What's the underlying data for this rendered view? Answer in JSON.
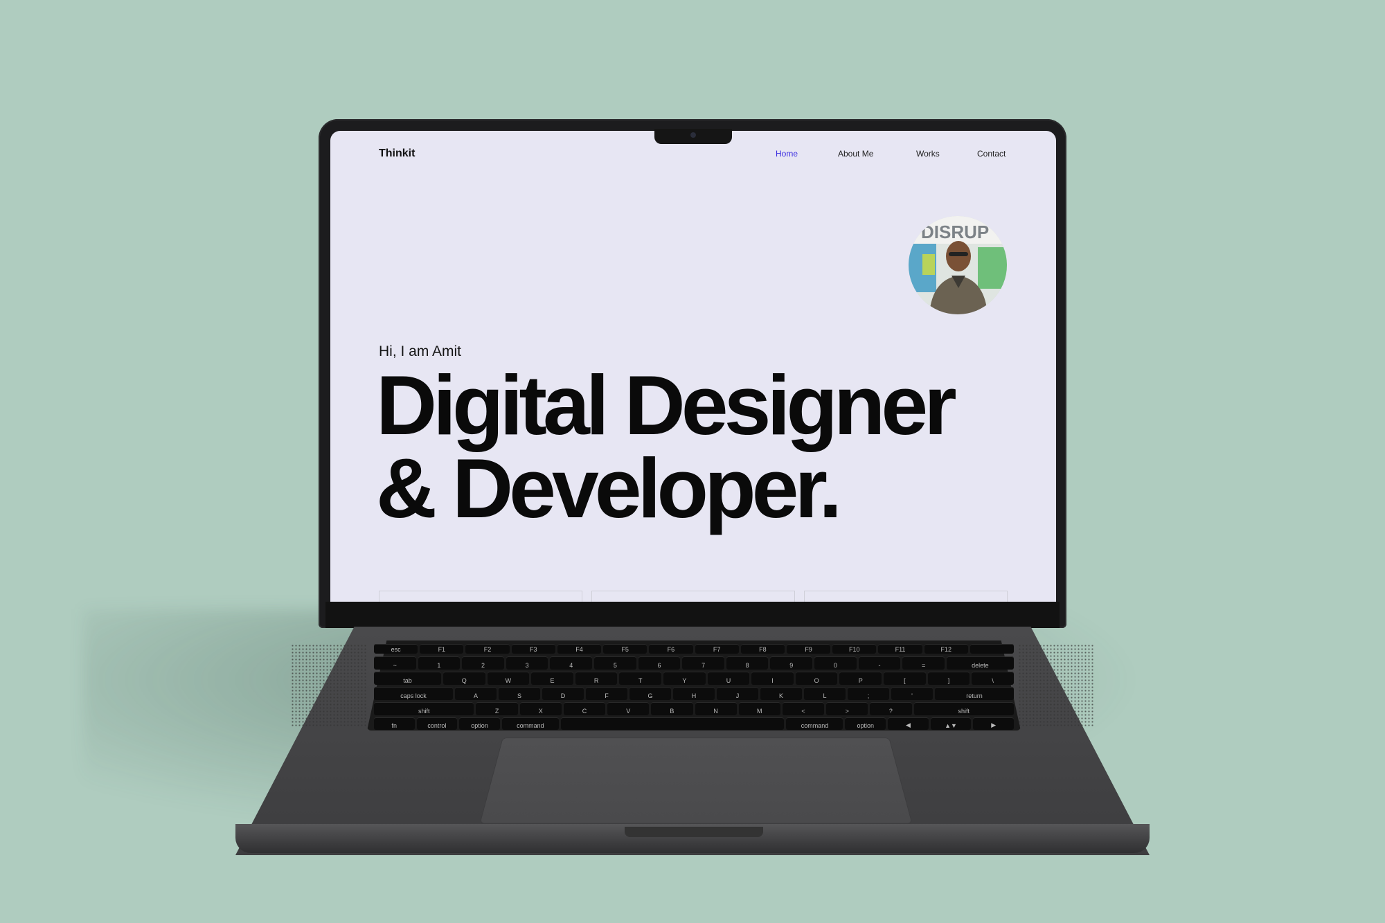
{
  "site": {
    "logo": "Thinkit",
    "nav": [
      {
        "label": "Home",
        "active": true
      },
      {
        "label": "About Me",
        "active": false
      },
      {
        "label": "Works",
        "active": false
      },
      {
        "label": "Contact",
        "active": false
      }
    ],
    "greeting": "Hi, I am Amit",
    "headline_line1": "Digital Designer",
    "headline_line2": "& Developer.",
    "avatar_sign_text": "DISRUP",
    "accent_color": "#3b2ee0",
    "background_color": "#e7e6f3"
  },
  "keyboard": {
    "row1": [
      "esc",
      "F1",
      "F2",
      "F3",
      "F4",
      "F5",
      "F6",
      "F7",
      "F8",
      "F9",
      "F10",
      "F11",
      "F12",
      ""
    ],
    "row2": [
      "~",
      "1",
      "2",
      "3",
      "4",
      "5",
      "6",
      "7",
      "8",
      "9",
      "0",
      "-",
      "=",
      "delete"
    ],
    "row3": [
      "tab",
      "Q",
      "W",
      "E",
      "R",
      "T",
      "Y",
      "U",
      "I",
      "O",
      "P",
      "[",
      "]",
      "\\"
    ],
    "row4": [
      "caps lock",
      "A",
      "S",
      "D",
      "F",
      "G",
      "H",
      "J",
      "K",
      "L",
      ";",
      "'",
      "return"
    ],
    "row5": [
      "shift",
      "Z",
      "X",
      "C",
      "V",
      "B",
      "N",
      "M",
      "<",
      ">",
      "?",
      "shift"
    ],
    "row6": [
      "fn",
      "control",
      "option",
      "command",
      "",
      "command",
      "option",
      "◀",
      "▲▼",
      "▶"
    ]
  },
  "scene_background": "#afccbf"
}
